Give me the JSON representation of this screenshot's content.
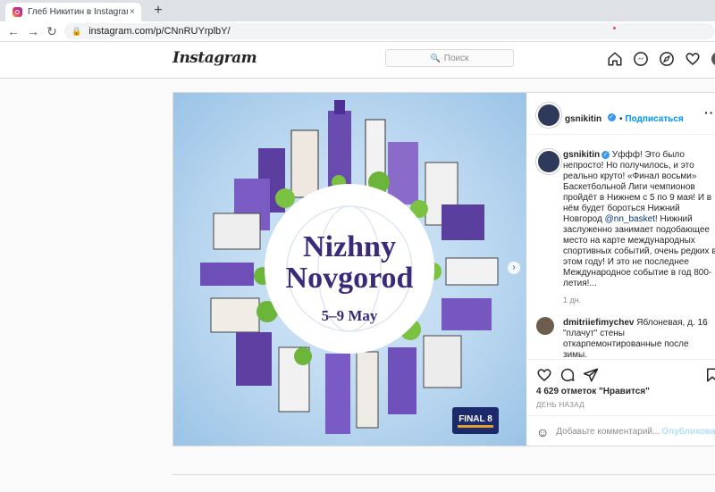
{
  "browser": {
    "tab_title": "Глеб Никитин в Instagram: «Уфф",
    "tab_close": "×",
    "new_tab": "+",
    "url": "instagram.com/p/CNnRUYrplbY/"
  },
  "header": {
    "logo": "Instagram",
    "search_placeholder": "Поиск",
    "icons": [
      "home-icon",
      "messenger-icon",
      "explore-icon",
      "heart-icon"
    ]
  },
  "post": {
    "image": {
      "title_line1": "Nizhny",
      "title_line2": "Novgorod",
      "dates": "5–9 May",
      "badge": "FINAL 8"
    },
    "author": "gsnikitin",
    "follow_label": "Подписаться",
    "caption_parts": [
      "Уффф! Это было непросто! Но получилось, и это реально круто! «Финал восьми» Баскетбольной Лиги чемпионов пройдёт в Нижнем с 5 по 9 мая! И в нём будет бороться Нижний Новгород ",
      "@nn_basket",
      "! Нижний заслуженно занимает подобающее место на карте международных спортивных событий, очень редких в этом году! И это не последнее Международное событие в год 800-летия!..."
    ],
    "caption_time": "1 дн.",
    "comment": {
      "user": "dmitriiefimychev",
      "text": "Яблоневая, д. 16 \"плачут\" стены откарпемонтированные после зимы."
    },
    "likes": "4 629 отметок \"Нравится\"",
    "posted_ago": "ДЕНЬ НАЗАД",
    "add_comment_placeholder": "Добавьте комментарий...",
    "publish_label": "Опубликовать"
  },
  "colors": {
    "accent": "#0095f6",
    "notification_dot": "#ed4956"
  }
}
